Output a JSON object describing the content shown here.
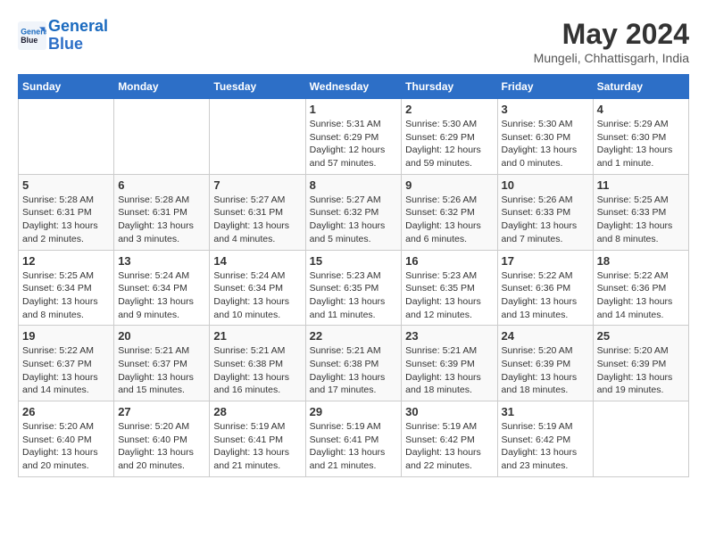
{
  "header": {
    "logo_line1": "General",
    "logo_line2": "Blue",
    "month": "May 2024",
    "location": "Mungeli, Chhattisgarh, India"
  },
  "days_of_week": [
    "Sunday",
    "Monday",
    "Tuesday",
    "Wednesday",
    "Thursday",
    "Friday",
    "Saturday"
  ],
  "weeks": [
    [
      {
        "day": "",
        "info": ""
      },
      {
        "day": "",
        "info": ""
      },
      {
        "day": "",
        "info": ""
      },
      {
        "day": "1",
        "info": "Sunrise: 5:31 AM\nSunset: 6:29 PM\nDaylight: 12 hours\nand 57 minutes."
      },
      {
        "day": "2",
        "info": "Sunrise: 5:30 AM\nSunset: 6:29 PM\nDaylight: 12 hours\nand 59 minutes."
      },
      {
        "day": "3",
        "info": "Sunrise: 5:30 AM\nSunset: 6:30 PM\nDaylight: 13 hours\nand 0 minutes."
      },
      {
        "day": "4",
        "info": "Sunrise: 5:29 AM\nSunset: 6:30 PM\nDaylight: 13 hours\nand 1 minute."
      }
    ],
    [
      {
        "day": "5",
        "info": "Sunrise: 5:28 AM\nSunset: 6:31 PM\nDaylight: 13 hours\nand 2 minutes."
      },
      {
        "day": "6",
        "info": "Sunrise: 5:28 AM\nSunset: 6:31 PM\nDaylight: 13 hours\nand 3 minutes."
      },
      {
        "day": "7",
        "info": "Sunrise: 5:27 AM\nSunset: 6:31 PM\nDaylight: 13 hours\nand 4 minutes."
      },
      {
        "day": "8",
        "info": "Sunrise: 5:27 AM\nSunset: 6:32 PM\nDaylight: 13 hours\nand 5 minutes."
      },
      {
        "day": "9",
        "info": "Sunrise: 5:26 AM\nSunset: 6:32 PM\nDaylight: 13 hours\nand 6 minutes."
      },
      {
        "day": "10",
        "info": "Sunrise: 5:26 AM\nSunset: 6:33 PM\nDaylight: 13 hours\nand 7 minutes."
      },
      {
        "day": "11",
        "info": "Sunrise: 5:25 AM\nSunset: 6:33 PM\nDaylight: 13 hours\nand 8 minutes."
      }
    ],
    [
      {
        "day": "12",
        "info": "Sunrise: 5:25 AM\nSunset: 6:34 PM\nDaylight: 13 hours\nand 8 minutes."
      },
      {
        "day": "13",
        "info": "Sunrise: 5:24 AM\nSunset: 6:34 PM\nDaylight: 13 hours\nand 9 minutes."
      },
      {
        "day": "14",
        "info": "Sunrise: 5:24 AM\nSunset: 6:34 PM\nDaylight: 13 hours\nand 10 minutes."
      },
      {
        "day": "15",
        "info": "Sunrise: 5:23 AM\nSunset: 6:35 PM\nDaylight: 13 hours\nand 11 minutes."
      },
      {
        "day": "16",
        "info": "Sunrise: 5:23 AM\nSunset: 6:35 PM\nDaylight: 13 hours\nand 12 minutes."
      },
      {
        "day": "17",
        "info": "Sunrise: 5:22 AM\nSunset: 6:36 PM\nDaylight: 13 hours\nand 13 minutes."
      },
      {
        "day": "18",
        "info": "Sunrise: 5:22 AM\nSunset: 6:36 PM\nDaylight: 13 hours\nand 14 minutes."
      }
    ],
    [
      {
        "day": "19",
        "info": "Sunrise: 5:22 AM\nSunset: 6:37 PM\nDaylight: 13 hours\nand 14 minutes."
      },
      {
        "day": "20",
        "info": "Sunrise: 5:21 AM\nSunset: 6:37 PM\nDaylight: 13 hours\nand 15 minutes."
      },
      {
        "day": "21",
        "info": "Sunrise: 5:21 AM\nSunset: 6:38 PM\nDaylight: 13 hours\nand 16 minutes."
      },
      {
        "day": "22",
        "info": "Sunrise: 5:21 AM\nSunset: 6:38 PM\nDaylight: 13 hours\nand 17 minutes."
      },
      {
        "day": "23",
        "info": "Sunrise: 5:21 AM\nSunset: 6:39 PM\nDaylight: 13 hours\nand 18 minutes."
      },
      {
        "day": "24",
        "info": "Sunrise: 5:20 AM\nSunset: 6:39 PM\nDaylight: 13 hours\nand 18 minutes."
      },
      {
        "day": "25",
        "info": "Sunrise: 5:20 AM\nSunset: 6:39 PM\nDaylight: 13 hours\nand 19 minutes."
      }
    ],
    [
      {
        "day": "26",
        "info": "Sunrise: 5:20 AM\nSunset: 6:40 PM\nDaylight: 13 hours\nand 20 minutes."
      },
      {
        "day": "27",
        "info": "Sunrise: 5:20 AM\nSunset: 6:40 PM\nDaylight: 13 hours\nand 20 minutes."
      },
      {
        "day": "28",
        "info": "Sunrise: 5:19 AM\nSunset: 6:41 PM\nDaylight: 13 hours\nand 21 minutes."
      },
      {
        "day": "29",
        "info": "Sunrise: 5:19 AM\nSunset: 6:41 PM\nDaylight: 13 hours\nand 21 minutes."
      },
      {
        "day": "30",
        "info": "Sunrise: 5:19 AM\nSunset: 6:42 PM\nDaylight: 13 hours\nand 22 minutes."
      },
      {
        "day": "31",
        "info": "Sunrise: 5:19 AM\nSunset: 6:42 PM\nDaylight: 13 hours\nand 23 minutes."
      },
      {
        "day": "",
        "info": ""
      }
    ]
  ]
}
